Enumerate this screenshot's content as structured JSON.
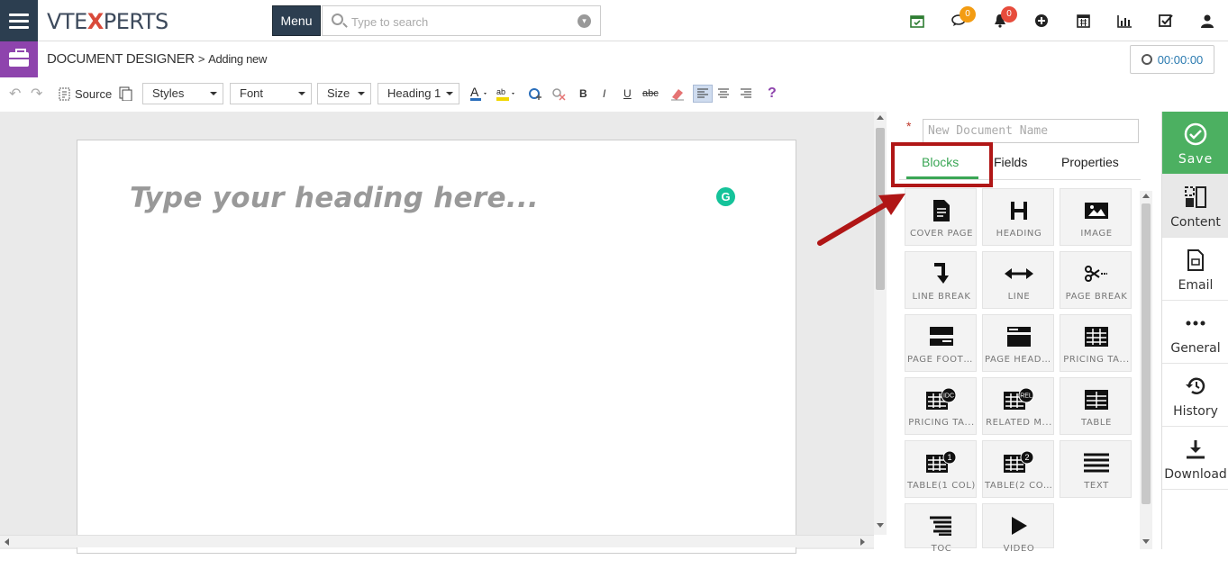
{
  "header": {
    "logo_prefix": "VTE",
    "logo_x": "X",
    "logo_suffix": "PERTS",
    "menu_label": "Menu",
    "search_placeholder": "Type to search",
    "chat_badge": "0",
    "notif_badge": "0"
  },
  "subheader": {
    "module": "DOCUMENT DESIGNER",
    "separator": ">",
    "action": "Adding new",
    "timer": "00:00:00"
  },
  "toolbar": {
    "source_label": "Source",
    "styles_label": "Styles",
    "font_label": "Font",
    "size_label": "Size",
    "format_label": "Heading 1",
    "bold": "B",
    "italic": "I",
    "underline": "U",
    "strike": "abc",
    "help": "?"
  },
  "editor": {
    "heading_placeholder": "Type your heading here...",
    "grammarly": "G"
  },
  "panel": {
    "required_mark": "*",
    "doc_name_placeholder": "New Document Name",
    "tabs": [
      {
        "label": "Blocks",
        "active": true
      },
      {
        "label": "Fields",
        "active": false
      },
      {
        "label": "Properties",
        "active": false
      }
    ],
    "blocks": [
      {
        "label": "COVER PAGE",
        "icon": "file-icon"
      },
      {
        "label": "HEADING",
        "icon": "heading-icon"
      },
      {
        "label": "IMAGE",
        "icon": "image-icon"
      },
      {
        "label": "LINE BREAK",
        "icon": "line-break-icon"
      },
      {
        "label": "LINE",
        "icon": "arrows-horizontal-icon"
      },
      {
        "label": "PAGE BREAK",
        "icon": "scissors-icon"
      },
      {
        "label": "PAGE FOOTER",
        "icon": "page-footer-icon"
      },
      {
        "label": "PAGE HEADER",
        "icon": "page-header-icon"
      },
      {
        "label": "PRICING TA...",
        "icon": "table-icon"
      },
      {
        "label": "PRICING TA...",
        "icon": "table-idc-icon",
        "badge": "IDC"
      },
      {
        "label": "RELATED M...",
        "icon": "table-rel-icon",
        "badge": "REL"
      },
      {
        "label": "TABLE",
        "icon": "table-icon"
      },
      {
        "label": "TABLE(1 COL)",
        "icon": "table-1col-icon",
        "badge": "1"
      },
      {
        "label": "TABLE(2 CO...",
        "icon": "table-2col-icon",
        "badge": "2"
      },
      {
        "label": "TEXT",
        "icon": "text-lines-icon"
      },
      {
        "label": "TOC",
        "icon": "toc-icon"
      },
      {
        "label": "VIDEO",
        "icon": "play-icon"
      }
    ]
  },
  "sidebar": {
    "items": [
      {
        "label": "Save",
        "icon": "check-circle-icon"
      },
      {
        "label": "Content",
        "icon": "content-icon"
      },
      {
        "label": "Email",
        "icon": "email-doc-icon"
      },
      {
        "label": "General",
        "icon": "ellipsis-icon"
      },
      {
        "label": "History",
        "icon": "history-icon"
      },
      {
        "label": "Download",
        "icon": "download-icon"
      }
    ]
  },
  "colors": {
    "nav_dark": "#2c3e50",
    "purple": "#8e44ad",
    "green": "#4cb061",
    "highlight_red": "#b01616",
    "badge_orange": "#f39c12",
    "badge_red": "#e74c3c"
  }
}
